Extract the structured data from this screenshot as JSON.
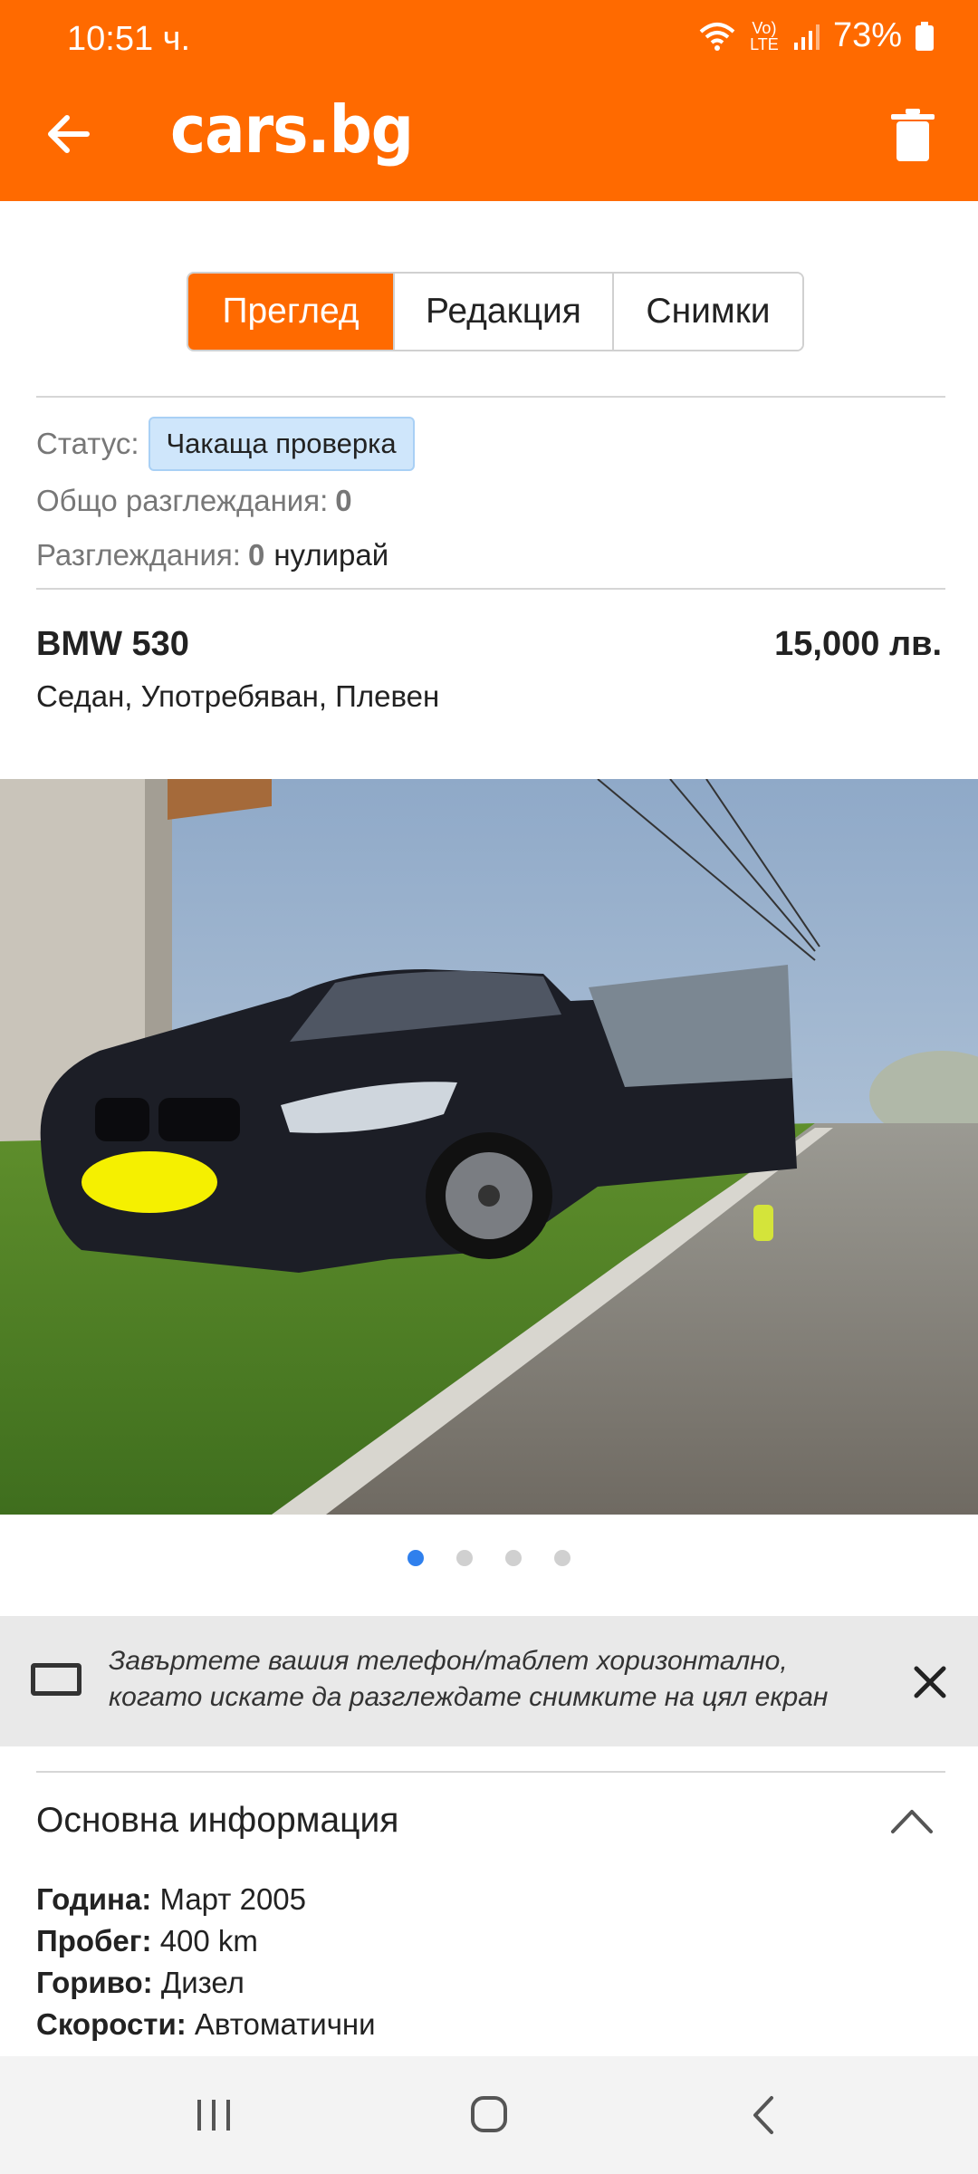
{
  "status_bar": {
    "time": "10:51 ч.",
    "network": "Vo) LTE",
    "battery": "73%"
  },
  "app_bar": {
    "logo": "cars.bg",
    "back_icon": "arrow-left-icon",
    "delete_icon": "trash-icon"
  },
  "tabs": [
    {
      "label": "Преглед",
      "active": true
    },
    {
      "label": "Редакция",
      "active": false
    },
    {
      "label": "Снимки",
      "active": false
    }
  ],
  "listing_status": {
    "status_label": "Статус:",
    "status_value": "Чакаща проверка",
    "total_views_label": "Общо разглеждания:",
    "total_views_value": "0",
    "views_label": "Разглеждания:",
    "views_value": "0",
    "reset_label": "нулирай"
  },
  "car": {
    "title": "BMW 530",
    "price": "15,000 лв.",
    "subtitle": "Седан, Употребяван, Плевен"
  },
  "gallery": {
    "total": 4,
    "active_index": 0
  },
  "rotate_hint": {
    "text": "Завъртете вашия телефон/таблет хоризонтално, когато искате да разглеждате снимките на цял екран",
    "icon": "tablet-landscape-icon",
    "close_icon": "close-icon"
  },
  "basic_info": {
    "title": "Основна информация",
    "items": [
      {
        "label": "Година:",
        "value": "Март 2005"
      },
      {
        "label": "Пробег:",
        "value": "400 km"
      },
      {
        "label": "Гориво:",
        "value": "Дизел"
      },
      {
        "label": "Скорости:",
        "value": "Автоматични"
      }
    ]
  },
  "colors": {
    "brand": "#ff6a00",
    "badge_bg": "#cfe6fb",
    "dot_active": "#2f80ed"
  }
}
